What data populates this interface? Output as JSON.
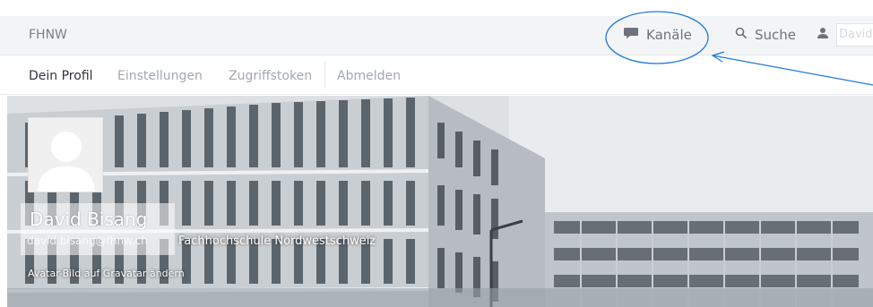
{
  "header": {
    "brand": "FHNW",
    "nav": {
      "channels_label": "Kanäle",
      "search_label": "Suche",
      "user_label": "David"
    }
  },
  "subnav": {
    "items": [
      {
        "label": "Dein Profil",
        "active": true
      },
      {
        "label": "Einstellungen",
        "active": false
      },
      {
        "label": "Zugriffstoken",
        "active": false
      },
      {
        "label": "Abmelden",
        "active": false
      }
    ]
  },
  "profile": {
    "name": "David Bisang",
    "email": "david.bisang@fhnw.ch",
    "organization": "Fachhochschule Nordwestschweiz",
    "gravatar_link": "Avatar-Bild auf Gravatar ändern"
  },
  "colors": {
    "annotation": "#1f7bd6"
  },
  "icons": {
    "channels": "chat-bubble-icon",
    "search": "search-icon",
    "user": "user-icon"
  }
}
